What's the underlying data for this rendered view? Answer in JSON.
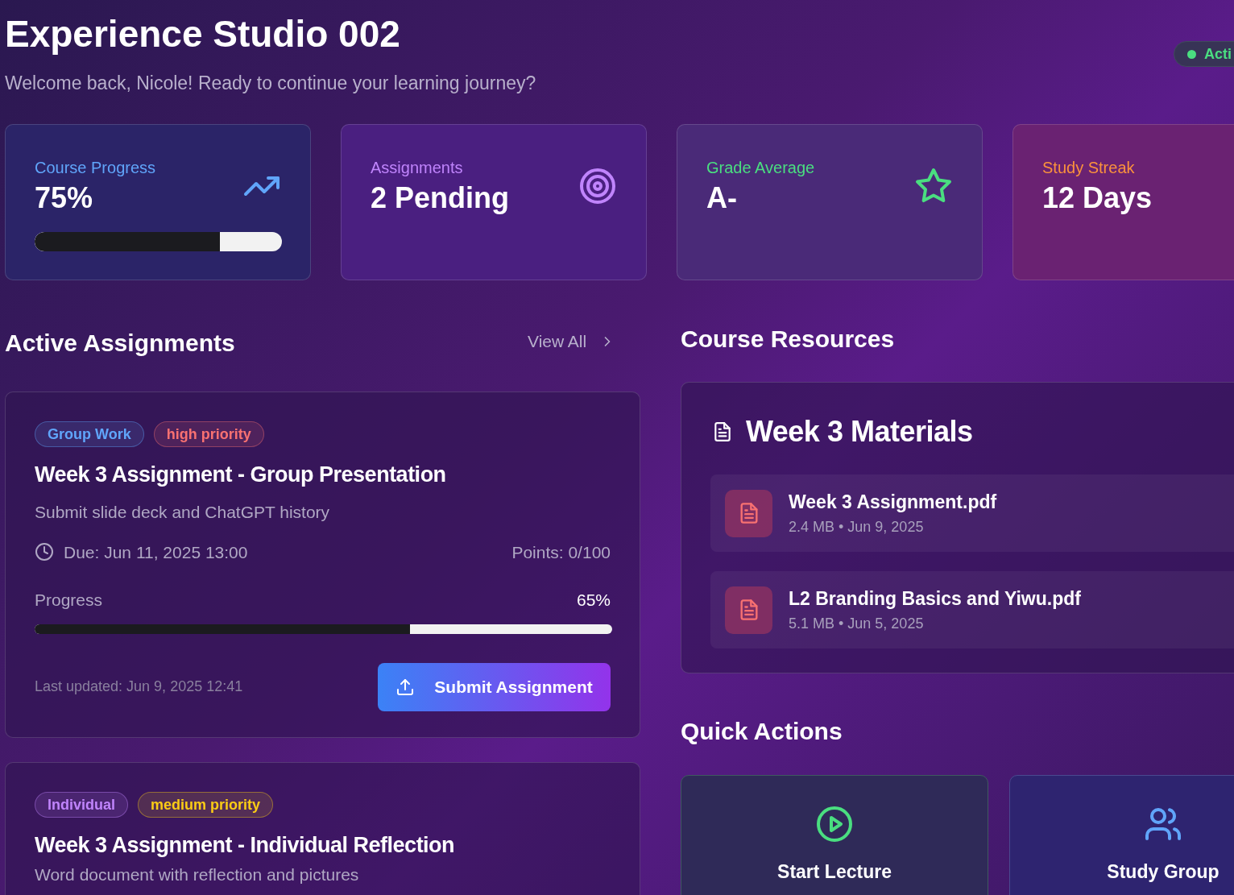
{
  "header": {
    "title": "Experience Studio 002",
    "subtitle": "Welcome back, Nicole! Ready to continue your learning journey?",
    "status": {
      "label": "Acti",
      "color": "#4ade80"
    }
  },
  "stats": [
    {
      "kind": "progress",
      "label": "Course Progress",
      "value": "75%",
      "color": "#60a5fa",
      "level": 0.75
    },
    {
      "kind": "target",
      "label": "Assignments",
      "value": "2 Pending",
      "color": "#c084fc"
    },
    {
      "kind": "star",
      "label": "Grade Average",
      "value": "A-",
      "color": "#4ade80"
    },
    {
      "kind": "plain",
      "label": "Study Streak",
      "value": "12 Days",
      "color": "#fb923c"
    }
  ],
  "assignments_section": {
    "title": "Active Assignments",
    "view_all": "View All"
  },
  "assignments": [
    {
      "tags": [
        {
          "label": "Group Work",
          "color": "#60a5fa"
        },
        {
          "label": "high priority",
          "color": "#f87171"
        }
      ],
      "title": "Week 3 Assignment - Group Presentation",
      "description": "Submit slide deck and ChatGPT history",
      "due": "Due: Jun 11, 2025 13:00",
      "points": "Points: 0/100",
      "progress_label": "Progress",
      "progress_value": "65%",
      "level": 0.65,
      "updated": "Last updated: Jun 9, 2025 12:41",
      "button": "Submit Assignment"
    },
    {
      "tags": [
        {
          "label": "Individual",
          "color": "#c084fc"
        },
        {
          "label": "medium priority",
          "color": "#facc15"
        }
      ],
      "title": "Week 3 Assignment - Individual Reflection",
      "description": "Word document with reflection and pictures"
    }
  ],
  "resources": {
    "title": "Course Resources",
    "card_title": "Week 3 Materials",
    "files": [
      {
        "name": "Week 3 Assignment.pdf",
        "meta": "2.4 MB • Jun 9, 2025"
      },
      {
        "name": "L2 Branding Basics and Yiwu.pdf",
        "meta": "5.1 MB • Jun 5, 2025"
      }
    ]
  },
  "quick_actions": {
    "title": "Quick Actions",
    "items": [
      {
        "kind": "lecture",
        "label": "Start Lecture"
      },
      {
        "kind": "group",
        "label": "Study Group"
      }
    ]
  }
}
